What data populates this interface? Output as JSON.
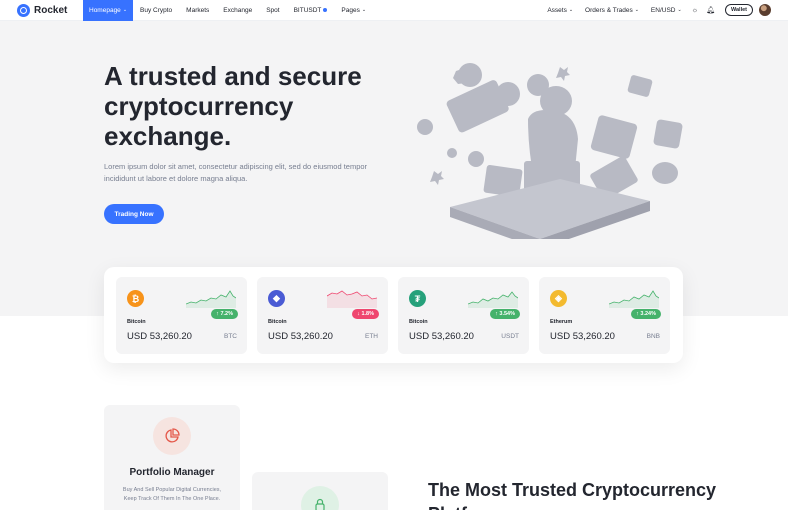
{
  "brand": {
    "name": "Rocket"
  },
  "nav": {
    "items": [
      {
        "label": "Homepage",
        "active": true,
        "dropdown": true
      },
      {
        "label": "Buy Crypto"
      },
      {
        "label": "Markets"
      },
      {
        "label": "Exchange"
      },
      {
        "label": "Spot"
      },
      {
        "label": "BITUSDT"
      },
      {
        "label": "Pages",
        "dropdown": true
      }
    ],
    "right": {
      "assets": "Assets",
      "orders": "Orders & Trades",
      "locale": "EN/USD",
      "theme_icon": "sun-icon",
      "bell_icon": "bell-icon",
      "wallet": "Wallet"
    }
  },
  "hero": {
    "title": "A trusted and secure cryptocurrency exchange.",
    "text": "Lorem ipsum dolor sit amet, consectetur adipiscing elit, sed do eiusmod tempor incididunt ut labore et dolore magna aliqua.",
    "cta": "Trading Now"
  },
  "tickers": [
    {
      "name": "Bitcoin",
      "price": "USD 53,260.20",
      "symbol": "BTC",
      "change": "↑ 7.2%",
      "trend": "up",
      "color": "#f7931a",
      "glyph": "₿"
    },
    {
      "name": "Bitcoin",
      "price": "USD 53,260.20",
      "symbol": "ETH",
      "change": "↓ 1.8%",
      "trend": "down",
      "color": "#4a5bd4",
      "glyph": "◆"
    },
    {
      "name": "Bitcoin",
      "price": "USD 53,260.20",
      "symbol": "USDT",
      "change": "↑ 3.54%",
      "trend": "up",
      "color": "#26a17b",
      "glyph": "₮"
    },
    {
      "name": "Etherum",
      "price": "USD 53,260.20",
      "symbol": "BNB",
      "change": "↑ 3.24%",
      "trend": "up",
      "color": "#f3ba2f",
      "glyph": "◈"
    }
  ],
  "features": {
    "portfolio": {
      "title": "Portfolio Manager",
      "text": "Buy And Sell Popular Digital Currencies, Keep Track Of Them In The One Place."
    },
    "trusted_title": "The Most Trusted Cryptocurrency Platform"
  },
  "colors": {
    "accent": "#3772ff",
    "up": "#45b26b",
    "down": "#ef466f"
  }
}
